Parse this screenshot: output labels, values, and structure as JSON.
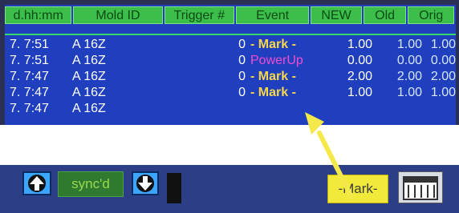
{
  "table": {
    "headers": [
      "d.hh:mm",
      "Mold ID",
      "Trigger #",
      "Event",
      "NEW",
      "Old",
      "Orig"
    ],
    "rows": [
      {
        "time": "7. 7:51",
        "mold": "A 16Z",
        "trigger": "0",
        "event": "- Mark -",
        "new": "1.00",
        "old": "1.00",
        "orig": "1.00",
        "event_type": "mark"
      },
      {
        "time": "7. 7:51",
        "mold": "A 16Z",
        "trigger": "0",
        "event": "PowerUp",
        "new": "0.00",
        "old": "0.00",
        "orig": "0.00",
        "event_type": "power"
      },
      {
        "time": "7. 7:47",
        "mold": "A 16Z",
        "trigger": "0",
        "event": "- Mark -",
        "new": "2.00",
        "old": "2.00",
        "orig": "2.00",
        "event_type": "mark"
      },
      {
        "time": "7. 7:47",
        "mold": "A 16Z",
        "trigger": "0",
        "event": "- Mark -",
        "new": "1.00",
        "old": "1.00",
        "orig": "1.00",
        "event_type": "mark"
      },
      {
        "time": "7. 7:47",
        "mold": "A 16Z",
        "trigger": "",
        "event": "",
        "new": "",
        "old": "",
        "orig": "",
        "event_type": "mark"
      }
    ]
  },
  "toolbar": {
    "sync_label": "sync'd",
    "mark_label": "-Mark-",
    "hint_text": ""
  },
  "icons": {
    "up": "up-arrow-icon",
    "down": "down-arrow-icon",
    "calendar": "calendar-icon"
  },
  "colors": {
    "screen_bg": "#1f3fbf",
    "header_bg": "#3cbf4a",
    "mark_text": "#f7d64a",
    "power_text": "#f04cd0",
    "mark_button": "#f2ea3a",
    "annotation_arrow": "#f4e84a"
  }
}
